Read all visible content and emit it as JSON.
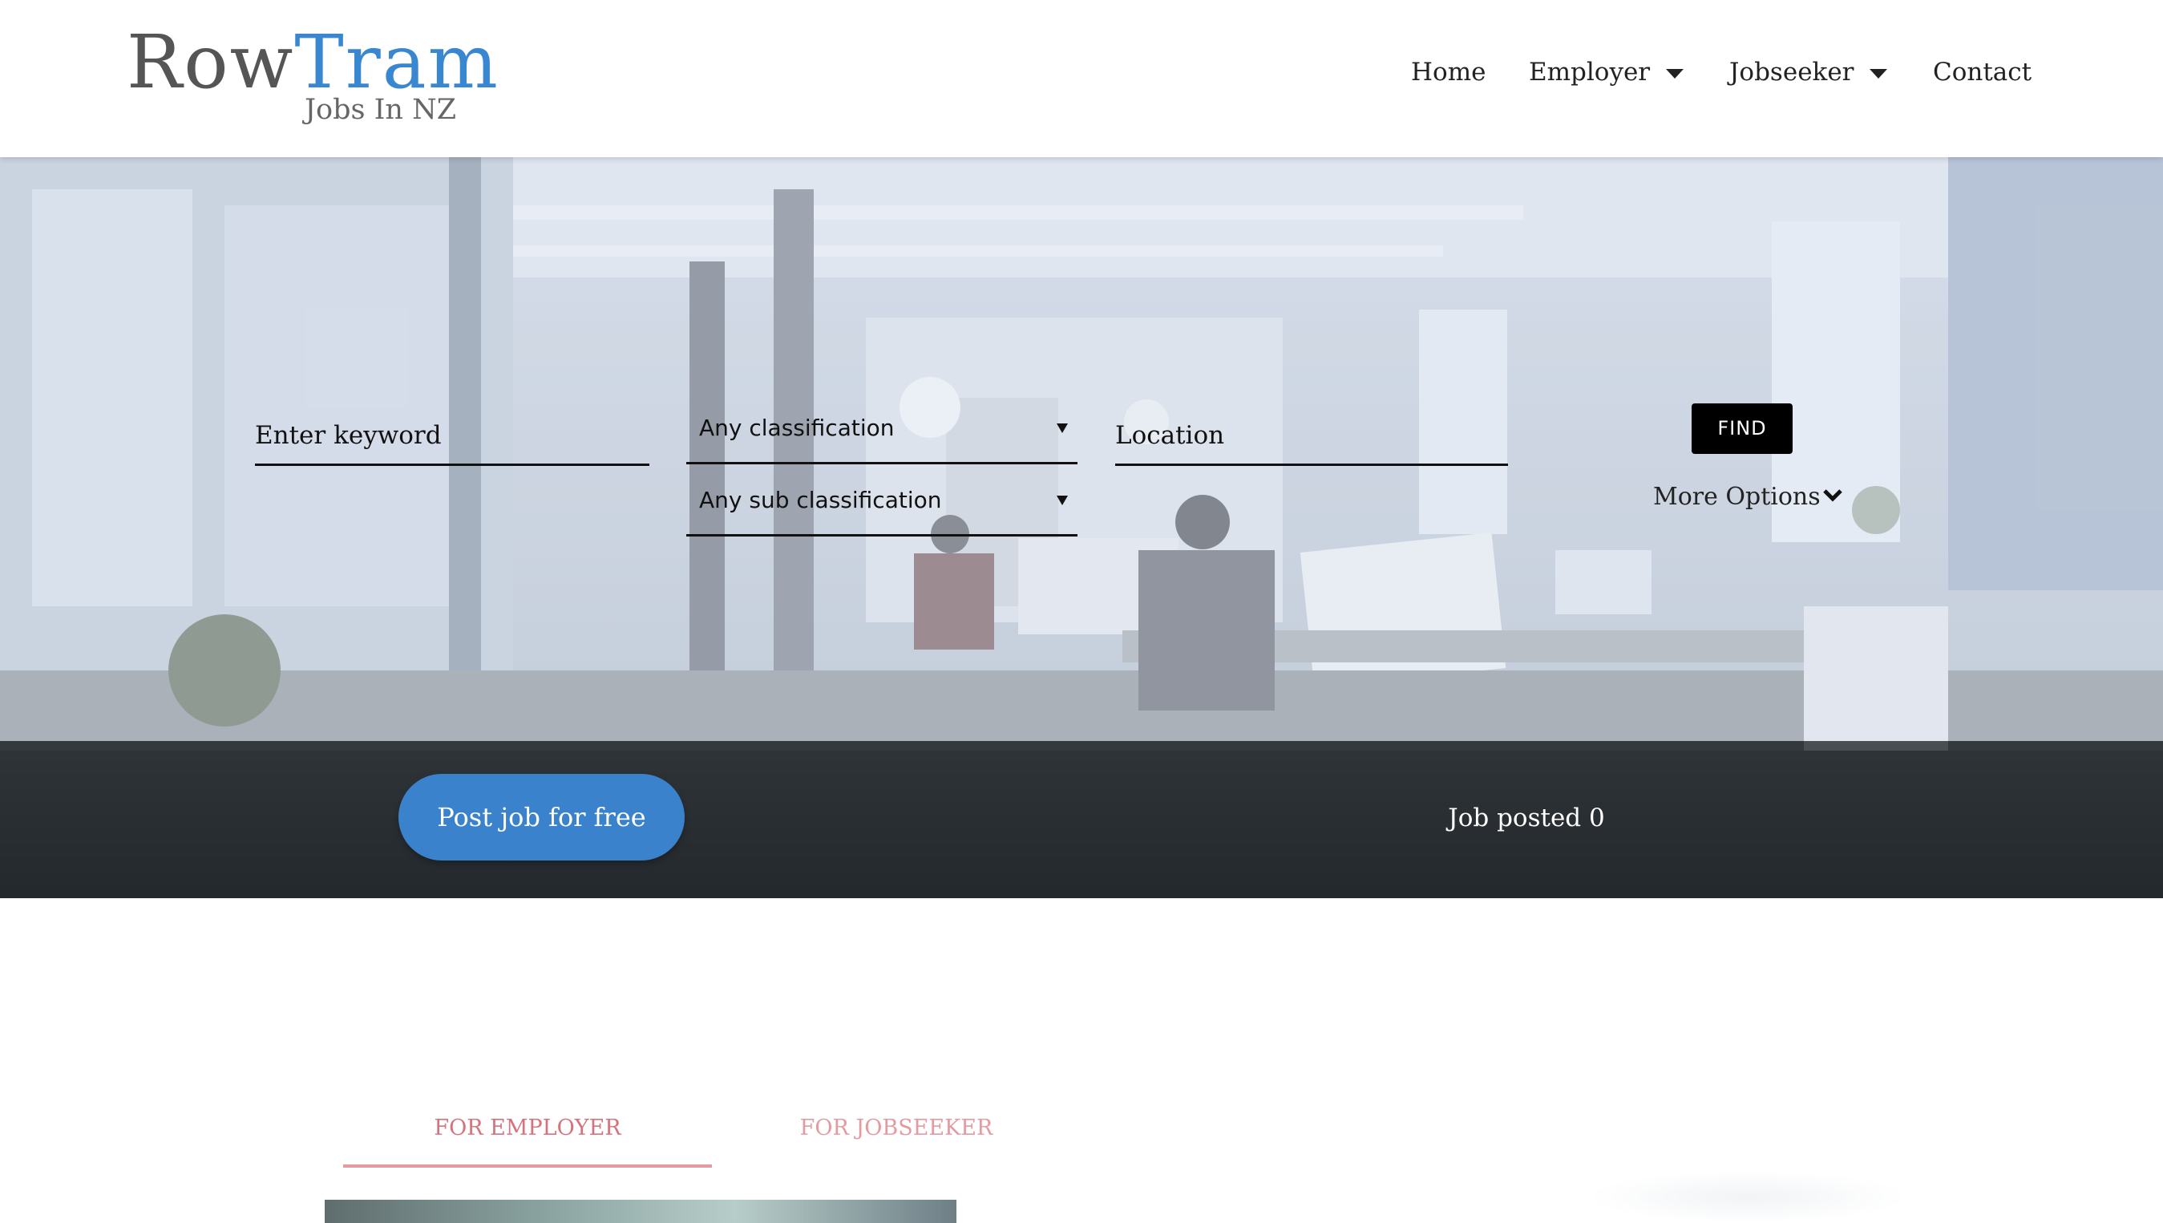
{
  "brand": {
    "name_part1": "Row",
    "name_part2": "Tram",
    "tagline": "Jobs In NZ",
    "accent_color": "#3a87d1"
  },
  "nav": {
    "items": [
      {
        "label": "Home"
      },
      {
        "label": "Employer"
      },
      {
        "label": "Jobseeker"
      },
      {
        "label": "Contact"
      }
    ]
  },
  "search": {
    "keyword_placeholder": "Enter keyword",
    "classification_value": "Any classification",
    "sub_classification_value": "Any sub classification",
    "location_placeholder": "Location",
    "find_label": "FIND",
    "more_options_label": "More Options"
  },
  "band": {
    "post_job_label": "Post job for free",
    "job_posted_text": "Job posted 0"
  },
  "tabs": [
    {
      "label": "FOR EMPLOYER",
      "active": true
    },
    {
      "label": "FOR JOBSEEKER",
      "active": false
    }
  ],
  "colors": {
    "primary_button": "#3a83cc",
    "tab_text": "#d4737b"
  }
}
